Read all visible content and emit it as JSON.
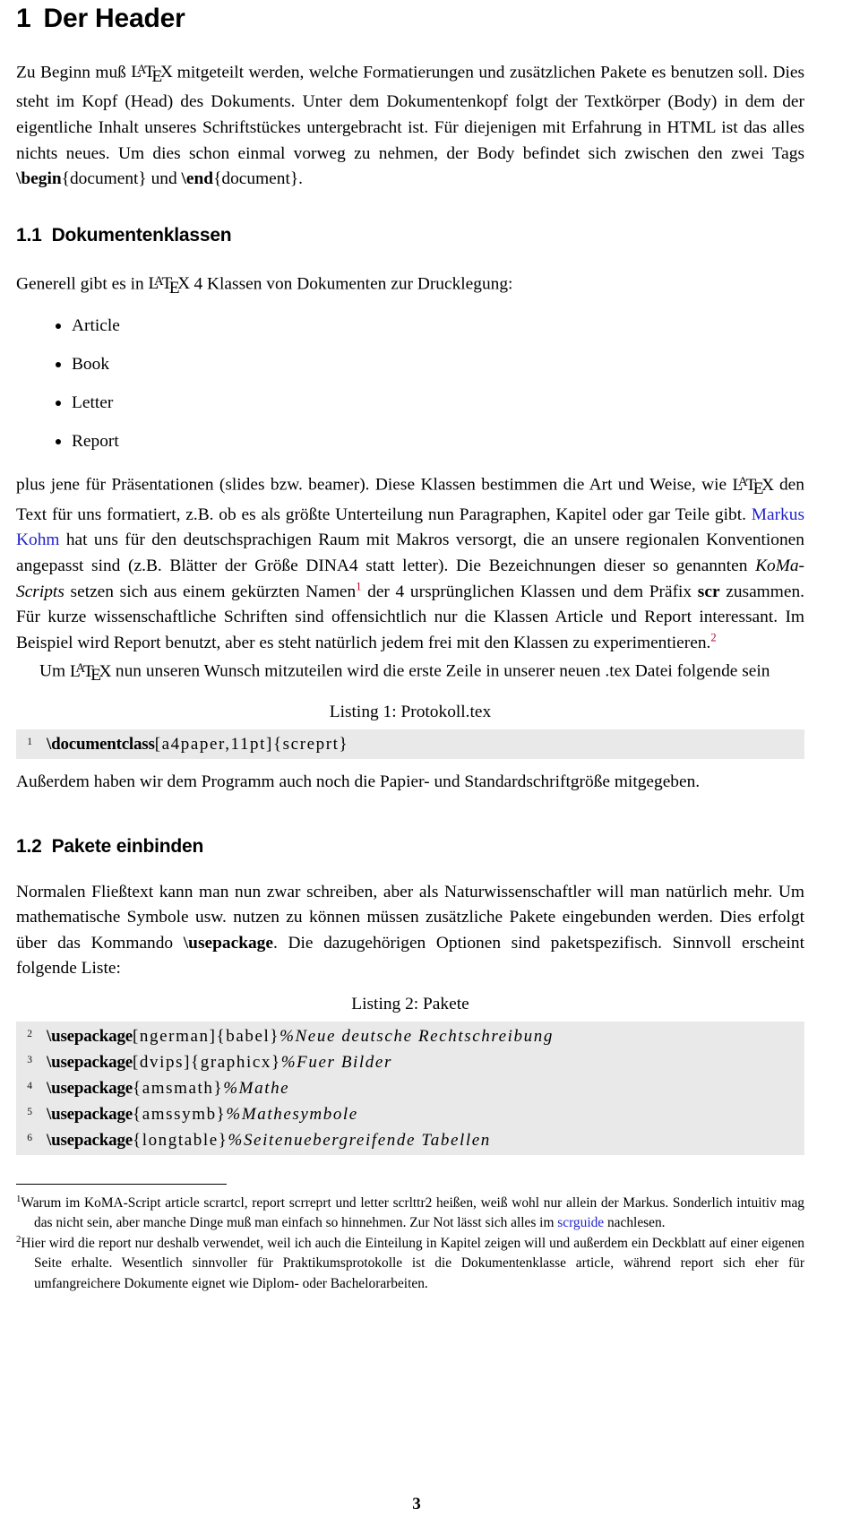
{
  "document": {
    "page_number": "3",
    "colors": {
      "link": "#2222cc",
      "footnote_mark": "#bb0022",
      "code_background": "#e9e9e9",
      "text": "#000000",
      "page_background": "#ffffff"
    }
  },
  "section": {
    "number": "1",
    "title": "Der Header",
    "paragraph_1": {
      "part_a": "Zu Beginn muß ",
      "latex_1": "LaTeX",
      "part_b": " mitgeteilt werden, welche Formatierungen und zusätzlichen Pakete es benutzen soll. Dies steht im Kopf (Head) des Dokuments. Unter dem Dokumentenkopf folgt der Textkörper (Body) in dem der eigentliche Inhalt unseres Schriftstückes untergebracht ist. Für diejenigen mit Erfahrung in HTML ist das alles nichts neues. Um dies schon einmal vorweg zu nehmen, der Body befindet sich zwischen den zwei Tags ",
      "cmd_begin": "\\begin",
      "arg_begin": "{document}",
      "joiner": " und ",
      "cmd_end": "\\end",
      "arg_end": "{document}."
    }
  },
  "subsection_1_1": {
    "number": "1.1",
    "title": "Dokumentenklassen",
    "intro_a": "Generell gibt es in ",
    "intro_latex": "LaTeX",
    "intro_b": " 4 Klassen von Dokumenten zur Drucklegung:",
    "classes": [
      {
        "label": "Article"
      },
      {
        "label": "Book"
      },
      {
        "label": "Letter"
      },
      {
        "label": "Report"
      }
    ],
    "paragraph_after_list": {
      "p1": "plus jene für Präsentationen (slides bzw. beamer). Diese Klassen bestimmen die Art und Weise, wie ",
      "latex": "LaTeX",
      "p2": " den Text für uns formatiert, z.B. ob es als größte Unterteilung nun Paragraphen, Kapitel oder gar Teile gibt. ",
      "link_markus": "Markus Kohm",
      "p3": " hat uns für den deutschsprachigen Raum mit Makros versorgt, die an unsere regionalen Konventionen angepasst sind (z.B. Blätter der Größe DINA4 statt letter). Die Bezeichnungen dieser so genannten ",
      "italic_koma": "KoMa-Scripts",
      "p4": " setzen sich aus einem gekürzten Namen",
      "fn1": "1",
      "p5": " der 4 ursprünglichen Klassen und dem Präfix ",
      "bold_scr": "scr",
      "p6": " zusammen. Für kurze wissenschaftliche Schriften sind offensichtlich nur die Klassen Article und Report interessant. Im Beispiel wird Report benutzt, aber es steht natürlich jedem frei mit den Klassen zu experimentieren.",
      "fn2": "2"
    },
    "paragraph_listing_intro": {
      "p1": "Um ",
      "latex": "LaTeX",
      "p2": " nun unseren Wunsch mitzuteilen wird die erste Zeile in unserer neuen .tex Datei folgende sein"
    },
    "listing_1": {
      "caption": "Listing 1: Protokoll.tex",
      "lines": [
        {
          "number": "1",
          "cmd": "\\documentclass",
          "args": "[a4paper,11pt]{screprt}",
          "comment": ""
        }
      ]
    },
    "paragraph_after_listing": "Außerdem haben wir dem Programm auch noch die Papier- und Standardschriftgröße mitgegeben."
  },
  "subsection_1_2": {
    "number": "1.2",
    "title": "Pakete einbinden",
    "paragraph": {
      "p1": "Normalen Fließtext kann man nun zwar schreiben, aber als Naturwissenschaftler will man natürlich mehr. Um mathematische Symbole usw. nutzen zu können müssen zusätzliche Pakete eingebunden werden. Dies erfolgt über das Kommando ",
      "cmd_usepackage": "\\usepackage",
      "p2": ". Die dazugehörigen Optionen sind paketspezifisch. Sinnvoll erscheint folgende Liste:"
    },
    "listing_2": {
      "caption": "Listing 2: Pakete",
      "lines": [
        {
          "number": "2",
          "cmd": "\\usepackage",
          "args": "[ngerman]{babel}",
          "comment": "%Neue deutsche Rechtschreibung"
        },
        {
          "number": "3",
          "cmd": "\\usepackage",
          "args": "[dvips]{graphicx}",
          "comment": "%Fuer Bilder"
        },
        {
          "number": "4",
          "cmd": "\\usepackage",
          "args": "{amsmath}",
          "comment": "%Mathe"
        },
        {
          "number": "5",
          "cmd": "\\usepackage",
          "args": "{amssymb}",
          "comment": "%Mathesymbole"
        },
        {
          "number": "6",
          "cmd": "\\usepackage",
          "args": "{longtable}",
          "comment": "%Seitenuebergreifende Tabellen"
        }
      ]
    }
  },
  "footnotes": [
    {
      "mark": "1",
      "text_a": "Warum im KoMA-Script article scrartcl, report scrreprt und letter scrlttr2 heißen, weiß wohl nur allein der Markus. Sonderlich intuitiv mag das nicht sein, aber manche Dinge muß man einfach so hinnehmen. Zur Not lässt sich alles im ",
      "link": "scrguide",
      "text_b": " nachlesen."
    },
    {
      "mark": "2",
      "text_a": "Hier wird die report nur deshalb verwendet, weil ich auch die Einteilung in Kapitel zeigen will und außerdem ein Deckblatt auf einer eigenen Seite erhalte. Wesentlich sinnvoller für Praktikumsprotokolle ist die Dokumentenklasse article, während report sich eher für umfangreichere Dokumente eignet wie Diplom- oder Bachelorarbeiten.",
      "link": "",
      "text_b": ""
    }
  ]
}
